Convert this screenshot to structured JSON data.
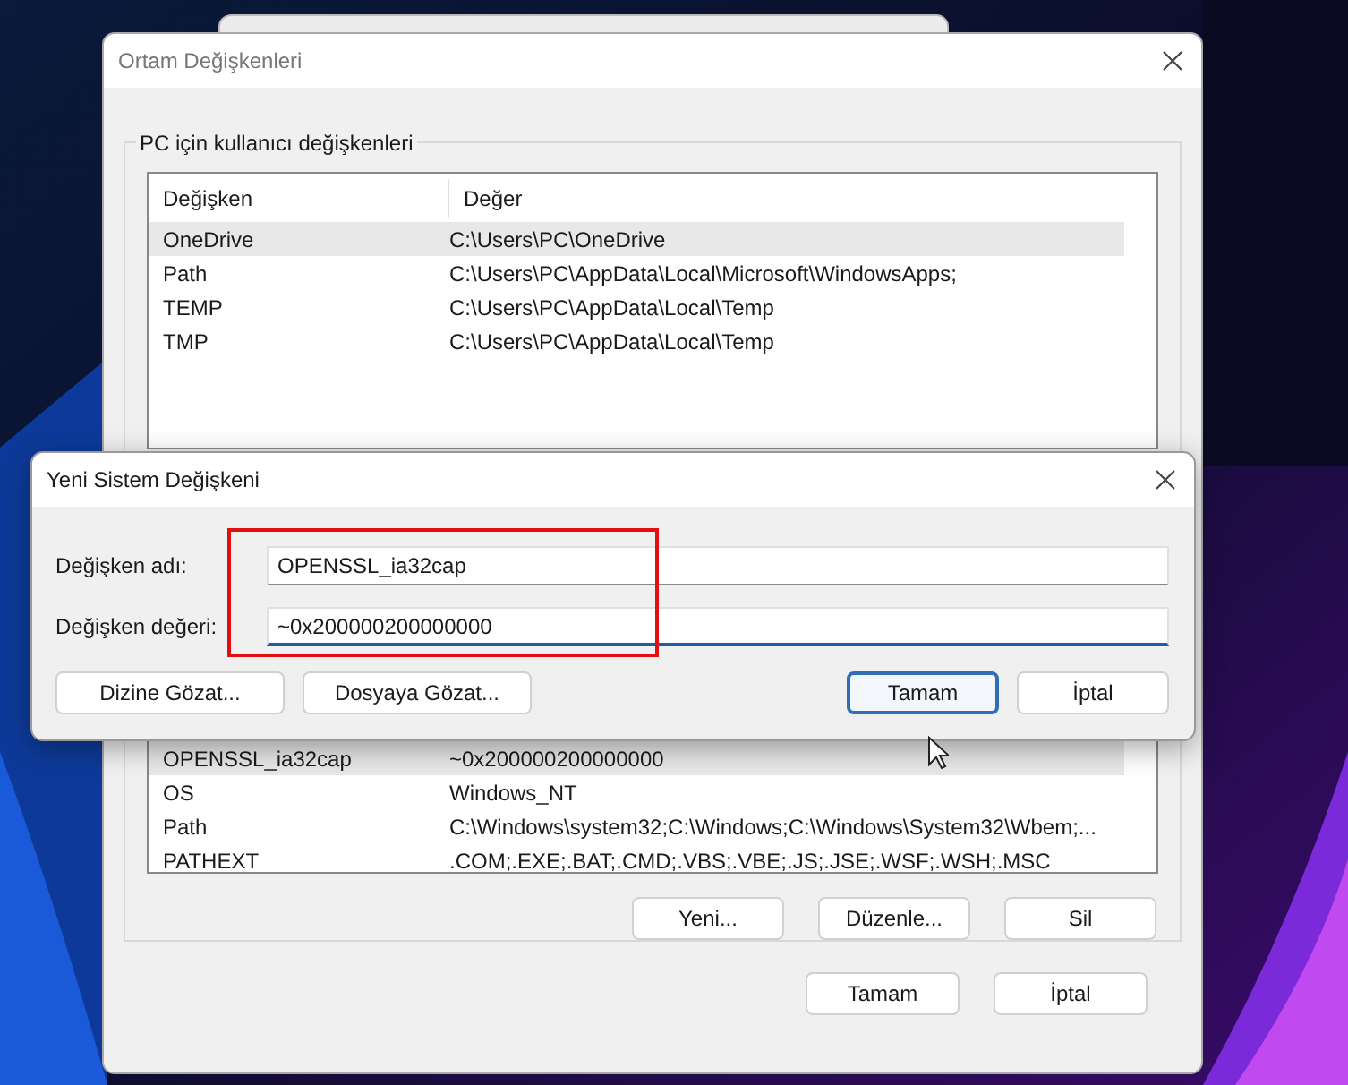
{
  "back_window": {
    "title": "Ortam Değişkenleri"
  },
  "user_variables": {
    "legend": "PC için kullanıcı değişkenleri",
    "columns": [
      "Değişken",
      "Değer"
    ],
    "rows": [
      {
        "cells": [
          "OneDrive",
          "C:\\Users\\PC\\OneDrive"
        ],
        "selected": true
      },
      {
        "cells": [
          "Path",
          "C:\\Users\\PC\\AppData\\Local\\Microsoft\\WindowsApps;"
        ],
        "selected": false
      },
      {
        "cells": [
          "TEMP",
          "C:\\Users\\PC\\AppData\\Local\\Temp"
        ],
        "selected": false
      },
      {
        "cells": [
          "TMP",
          "C:\\Users\\PC\\AppData\\Local\\Temp"
        ],
        "selected": false
      }
    ]
  },
  "system_variables": {
    "rows": [
      {
        "cells": [
          "OPENSSL_ia32cap",
          "~0x200000200000000"
        ],
        "selected": true
      },
      {
        "cells": [
          "OS",
          "Windows_NT"
        ],
        "selected": false
      },
      {
        "cells": [
          "Path",
          "C:\\Windows\\system32;C:\\Windows;C:\\Windows\\System32\\Wbem;..."
        ],
        "selected": false
      },
      {
        "cells": [
          "PATHEXT",
          ".COM;.EXE;.BAT;.CMD;.VBS;.VBE;.JS;.JSE;.WSF;.WSH;.MSC"
        ],
        "selected": false
      }
    ],
    "buttons": [
      "Yeni...",
      "Düzenle...",
      "Sil"
    ]
  },
  "footer_buttons": [
    {
      "label": "Tamam",
      "focused": false
    },
    {
      "label": "İptal",
      "focused": false
    }
  ],
  "dialog": {
    "title": "Yeni Sistem Değişkeni",
    "fields": [
      {
        "label": "Değişken adı:",
        "value": "OPENSSL_ia32cap",
        "focused": false
      },
      {
        "label": "Değişken değeri:",
        "value": "~0x200000200000000",
        "focused": true
      }
    ],
    "browse_buttons": [
      "Dizine Gözat...",
      "Dosyaya Gözat..."
    ],
    "buttons": [
      {
        "label": "Tamam",
        "focused": true
      },
      {
        "label": "İptal",
        "focused": false
      }
    ]
  }
}
